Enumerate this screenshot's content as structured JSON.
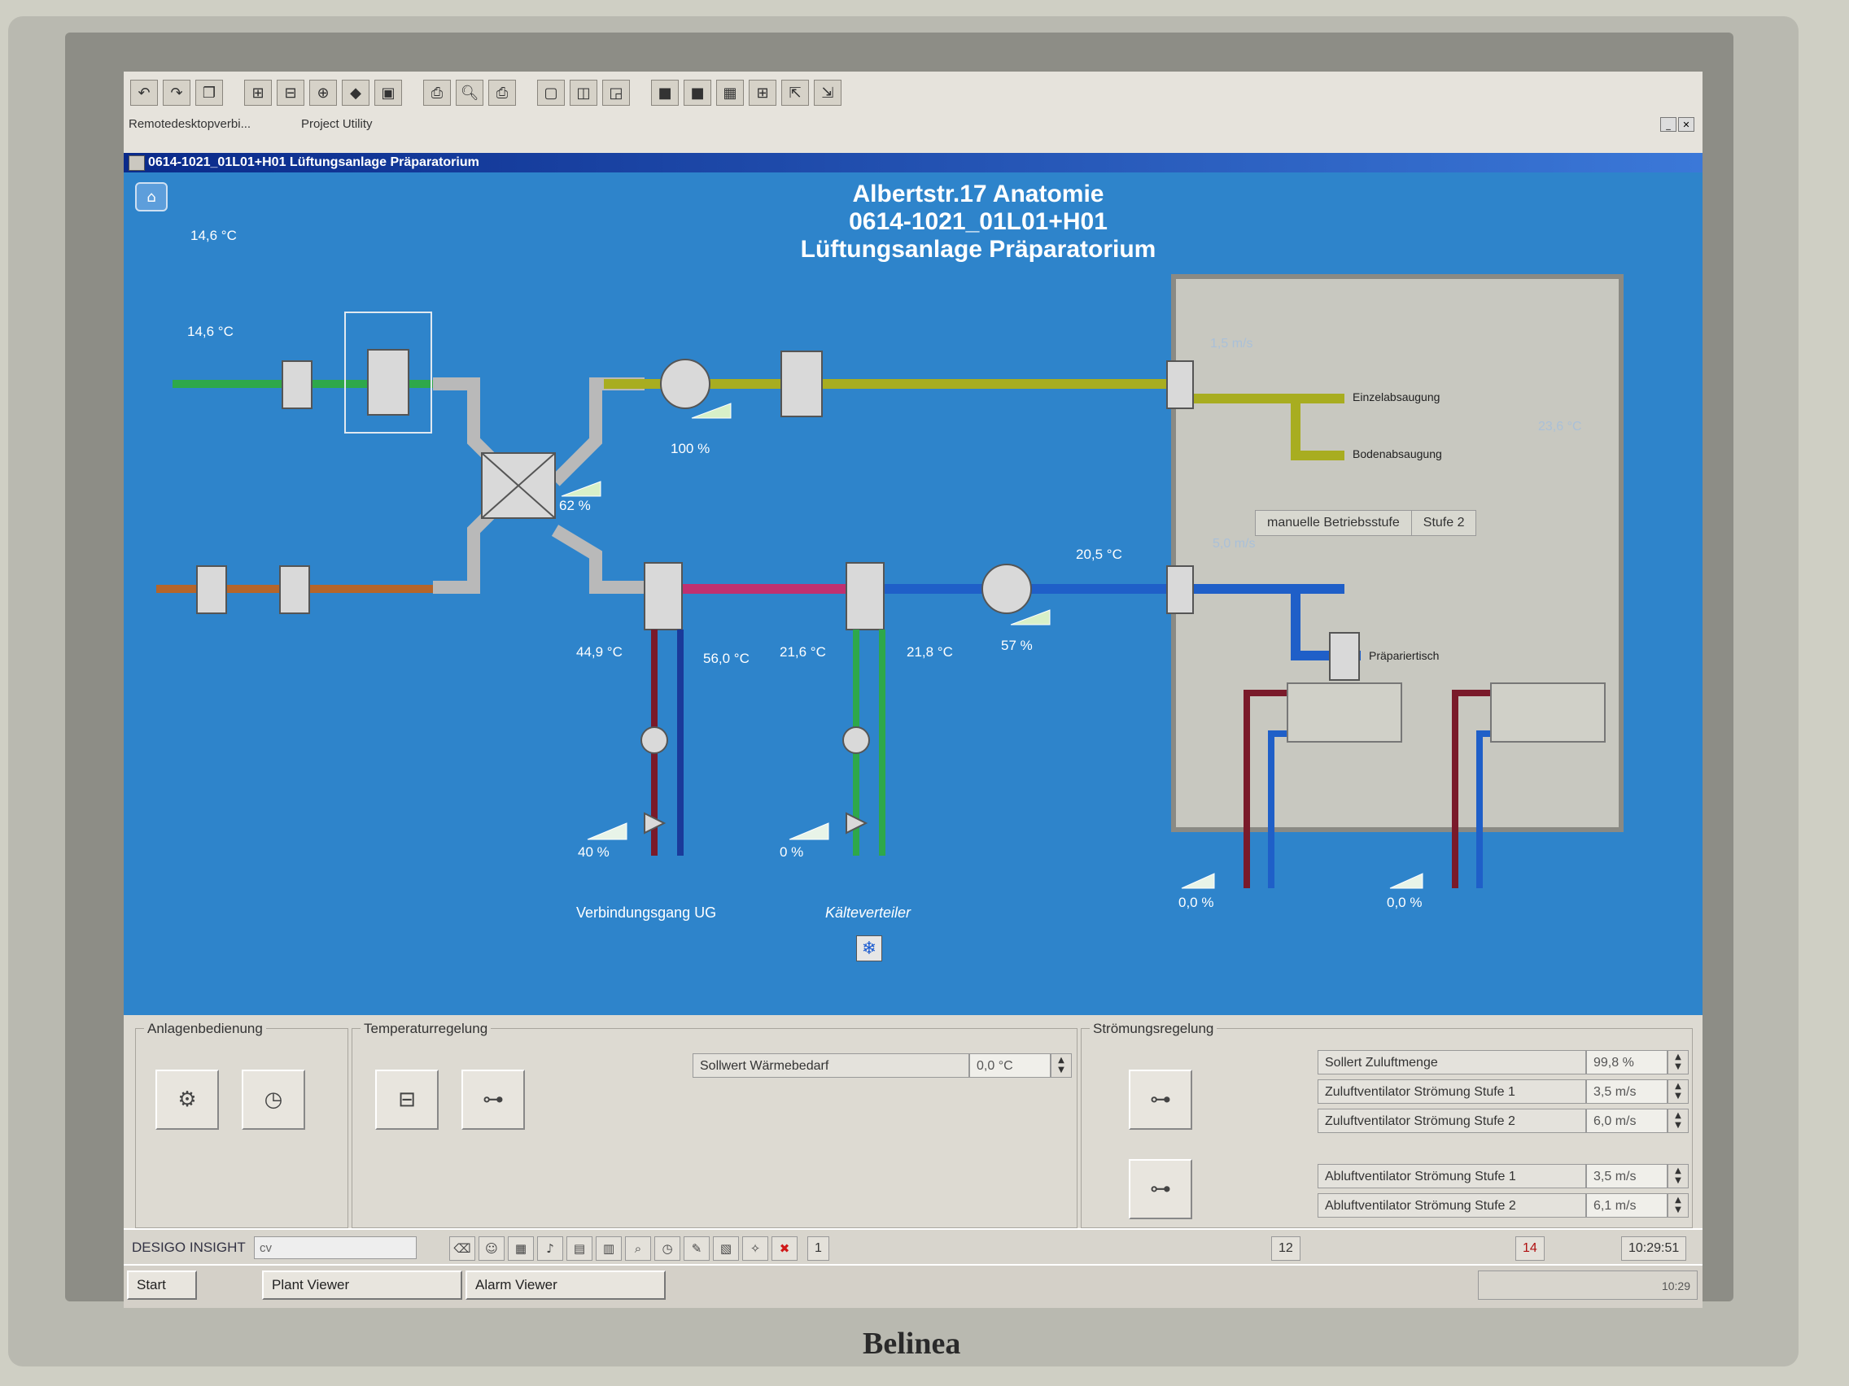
{
  "monitor": {
    "brand": "Belinea"
  },
  "toolbar": {
    "labels": [
      "Remotedesktopverbi...",
      "Project Utility"
    ]
  },
  "window": {
    "title": "0614-1021_01L01+H01 Lüftungsanlage Präparatorium"
  },
  "plant": {
    "title_line1": "Albertstr.17 Anatomie",
    "title_line2": "0614-1021_01L01+H01",
    "title_line3": "Lüftungsanlage Präparatorium",
    "outside_temp": "14,6 °C",
    "fresh_air_temp": "14,6 °C",
    "exhaust_fan_pct": "100 %",
    "heat_recovery_pct": "62 %",
    "supply_fan_pct": "57 %",
    "supply_temp": "20,5 °C",
    "heater_in_temp": "44,9 °C",
    "heater_out_temp": "56,0 °C",
    "cooler_in_temp": "21,6 °C",
    "cooler_out_temp": "21,8 °C",
    "heater_valve_pct": "40 %",
    "cooler_valve_pct": "0 %",
    "heater_source": "Verbindungsgang UG",
    "cooler_source": "Kälteverteiler",
    "exhaust_flow": "1,5 m/s",
    "supply_flow": "5,0 m/s",
    "exhaust_point_1": "Einzelabsaugung",
    "exhaust_point_2": "Bodenabsaugung",
    "room_temp": "23,6 °C",
    "supply_point": "Präpariertisch",
    "mode_label": "manuelle Betriebsstufe",
    "mode_value": "Stufe 2",
    "radiator_valve_1": "0,0 %",
    "radiator_valve_2": "0,0 %"
  },
  "panel": {
    "group1": "Anlagenbedienung",
    "group2": "Temperaturregelung",
    "group3": "Strömungsregelung",
    "setpoint_heat_label": "Sollwert Wärmebedarf",
    "setpoint_heat_value": "0,0 °C",
    "flow_rows": [
      {
        "label": "Sollert Zuluftmenge",
        "value": "99,8 %"
      },
      {
        "label": "Zuluftventilator Strömung Stufe 1",
        "value": "3,5 m/s"
      },
      {
        "label": "Zuluftventilator Strömung Stufe 2",
        "value": "6,0 m/s"
      },
      {
        "label": "Abluftventilator Strömung Stufe 1",
        "value": "3,5 m/s"
      },
      {
        "label": "Abluftventilator Strömung Stufe 2",
        "value": "6,1 m/s"
      }
    ]
  },
  "statusbar": {
    "logo": "DESIGO INSIGHT",
    "input_value": "cv",
    "alarm_count": "1",
    "count_12": "12",
    "count_14": "14",
    "time": "10:29:51"
  },
  "taskbar": {
    "start": "Start",
    "task1": "Plant Viewer",
    "task2": "Alarm Viewer",
    "clock": "10:29"
  },
  "colors": {
    "background": "#2e84cb",
    "exhaust_duct": "#a8ad20",
    "fresh_duct": "#2ea84a",
    "outgoing_duct": "#b5652a",
    "supply_hot": "#c03070",
    "supply_duct": "#1f5fc8"
  }
}
